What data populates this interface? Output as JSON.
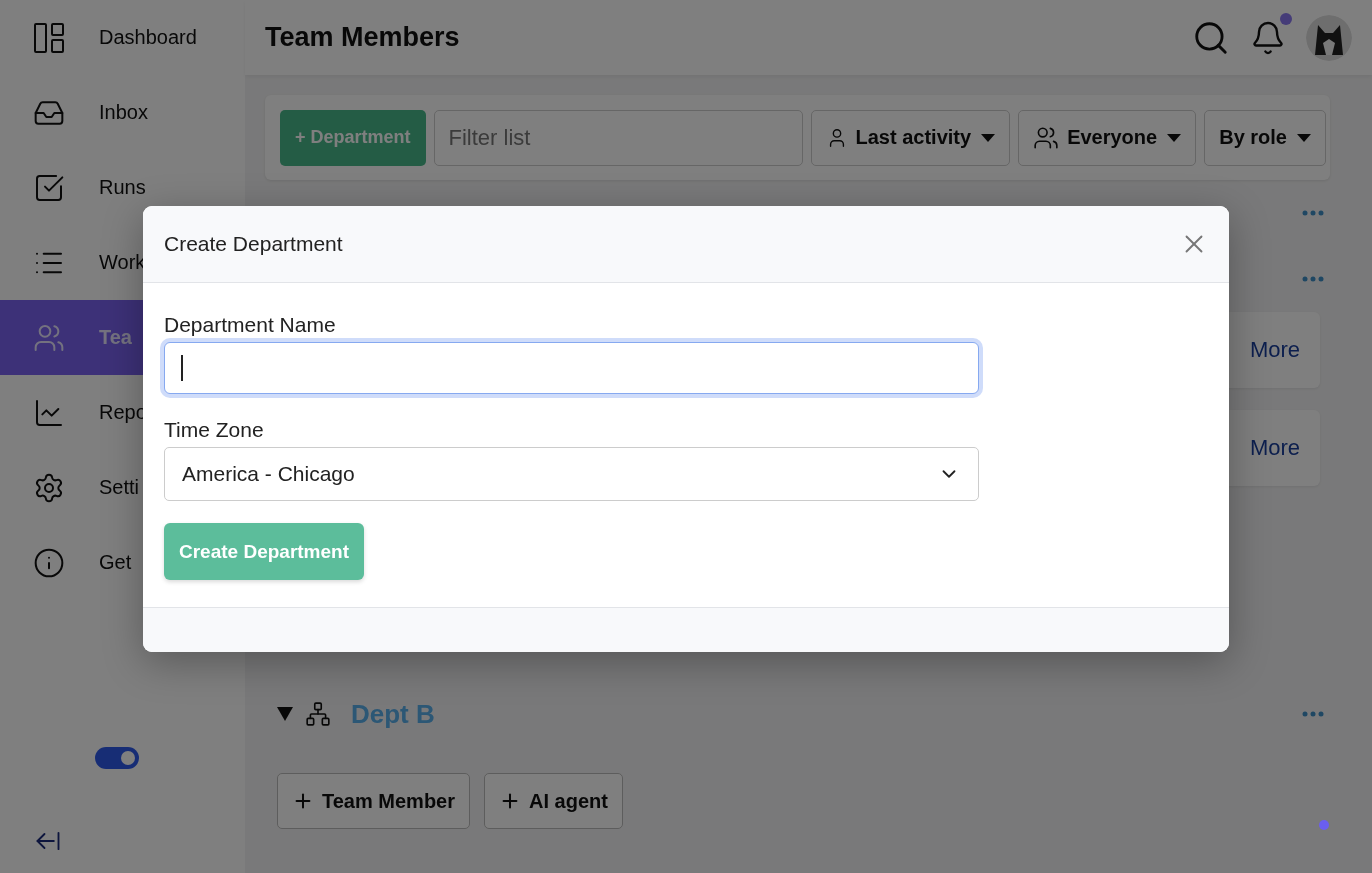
{
  "sidebar": {
    "items": [
      {
        "label": "Dashboard",
        "selected": false
      },
      {
        "label": "Inbox",
        "selected": false
      },
      {
        "label": "Runs",
        "selected": false
      },
      {
        "label": "Work",
        "selected": false
      },
      {
        "label": "Tea",
        "selected": true
      },
      {
        "label": "Repo",
        "selected": false
      },
      {
        "label": "Setti",
        "selected": false
      },
      {
        "label": "Get",
        "selected": false
      }
    ],
    "toggle": {
      "on": true
    }
  },
  "header": {
    "title": "Team Members",
    "has_notification": true
  },
  "toolbar": {
    "add_button": "+ Department",
    "filter": {
      "placeholder": "Filter list"
    },
    "dropdowns": [
      {
        "label": "Last activity",
        "kind": "person"
      },
      {
        "label": "Everyone",
        "kind": "group"
      },
      {
        "label": "By role",
        "kind": "plain"
      }
    ]
  },
  "cards": [
    {
      "link": "More"
    },
    {
      "link": "More"
    }
  ],
  "department": {
    "name": "Dept B",
    "expanded": true,
    "buttons": [
      "Team Member",
      "AI agent"
    ]
  },
  "modal": {
    "title": "Create Department",
    "name_field": {
      "label": "Department Name",
      "focused": true
    },
    "timezone_field": {
      "label": "Time Zone",
      "value": "America - Chicago"
    },
    "submit": "Create Department"
  }
}
